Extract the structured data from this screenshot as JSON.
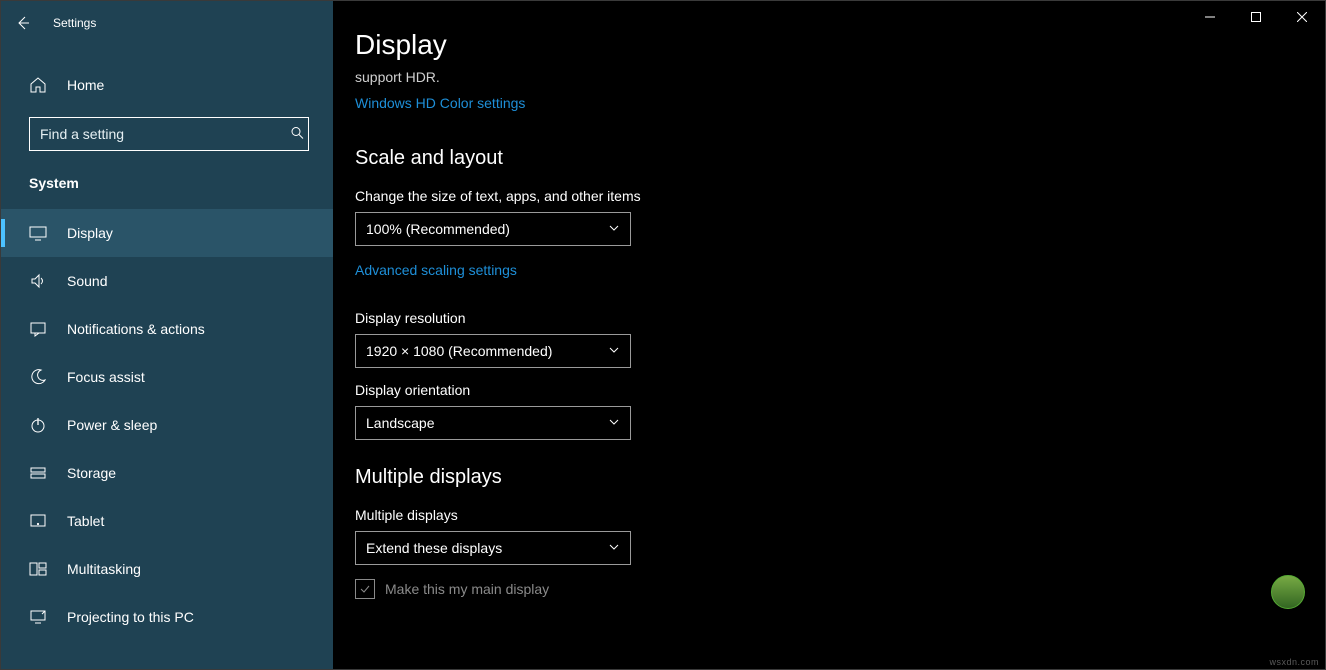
{
  "window": {
    "title": "Settings"
  },
  "sidebar": {
    "home_label": "Home",
    "search_placeholder": "Find a setting",
    "section_label": "System",
    "items": [
      {
        "icon": "display",
        "label": "Display",
        "selected": true
      },
      {
        "icon": "sound",
        "label": "Sound",
        "selected": false
      },
      {
        "icon": "notifications",
        "label": "Notifications & actions",
        "selected": false
      },
      {
        "icon": "focus",
        "label": "Focus assist",
        "selected": false
      },
      {
        "icon": "power",
        "label": "Power & sleep",
        "selected": false
      },
      {
        "icon": "storage",
        "label": "Storage",
        "selected": false
      },
      {
        "icon": "tablet",
        "label": "Tablet",
        "selected": false
      },
      {
        "icon": "multitask",
        "label": "Multitasking",
        "selected": false
      },
      {
        "icon": "projecting",
        "label": "Projecting to this PC",
        "selected": false
      }
    ]
  },
  "main": {
    "page_title": "Display",
    "hdr_sub": "support HDR.",
    "hdr_link": "Windows HD Color settings",
    "scale_layout_heading": "Scale and layout",
    "scale_label": "Change the size of text, apps, and other items",
    "scale_value": "100% (Recommended)",
    "advanced_scaling_link": "Advanced scaling settings",
    "resolution_label": "Display resolution",
    "resolution_value": "1920 × 1080 (Recommended)",
    "orientation_label": "Display orientation",
    "orientation_value": "Landscape",
    "multi_heading": "Multiple displays",
    "multi_label": "Multiple displays",
    "multi_value": "Extend these displays",
    "main_display_checkbox_label": "Make this my main display"
  },
  "watermark": "wsxdn.com"
}
